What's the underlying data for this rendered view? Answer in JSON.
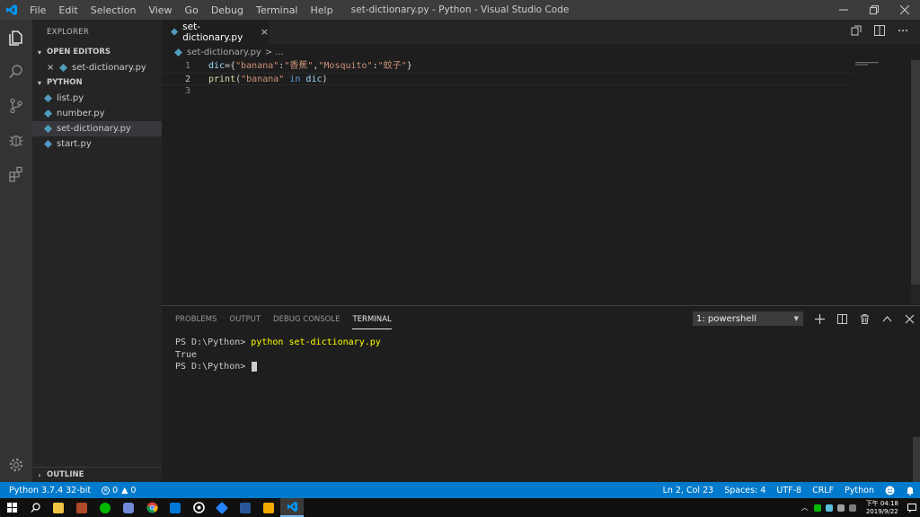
{
  "titlebar": {
    "menu": [
      "File",
      "Edit",
      "Selection",
      "View",
      "Go",
      "Debug",
      "Terminal",
      "Help"
    ],
    "title": "set-dictionary.py - Python - Visual Studio Code",
    "logo_color": "#0098ff"
  },
  "sidebar": {
    "header": "EXPLORER",
    "open_editors_label": "OPEN EDITORS",
    "open_editors": [
      {
        "label": "set-dictionary.py"
      }
    ],
    "folder_label": "PYTHON",
    "files": [
      {
        "label": "list.py"
      },
      {
        "label": "number.py"
      },
      {
        "label": "set-dictionary.py",
        "selected": true
      },
      {
        "label": "start.py"
      }
    ],
    "outline_label": "OUTLINE"
  },
  "editor": {
    "tab_label": "set-dictionary.py",
    "breadcrumb_file": "set-dictionary.py",
    "breadcrumb_more": "> ...",
    "lines": [
      {
        "number": "1",
        "tokens": [
          [
            "dic",
            "var"
          ],
          [
            "={",
            "pun"
          ],
          [
            "\"banana\"",
            "str"
          ],
          [
            ":",
            "pun"
          ],
          [
            "\"香蕉\"",
            "str"
          ],
          [
            ",",
            "pun"
          ],
          [
            "\"Mosquito\"",
            "str"
          ],
          [
            ":",
            "pun"
          ],
          [
            "\"蚊子\"",
            "str"
          ],
          [
            "}",
            "pun"
          ]
        ]
      },
      {
        "number": "2",
        "tokens": [
          [
            "print",
            "fn"
          ],
          [
            "(",
            "pun"
          ],
          [
            "\"banana\"",
            "str"
          ],
          [
            " ",
            "pun"
          ],
          [
            "in",
            "kw"
          ],
          [
            " ",
            "pun"
          ],
          [
            "dic",
            "var"
          ],
          [
            ")",
            "pun"
          ]
        ]
      },
      {
        "number": "3",
        "tokens": []
      }
    ],
    "current_line": 2
  },
  "panel": {
    "tabs": [
      "PROBLEMS",
      "OUTPUT",
      "DEBUG CONSOLE",
      "TERMINAL"
    ],
    "active_tab": "TERMINAL",
    "terminal_selector": "1: powershell",
    "terminal_lines": [
      {
        "prompt": "PS D:\\Python> ",
        "command": "python set-dictionary.py"
      },
      {
        "text": "True"
      },
      {
        "prompt": "PS D:\\Python> ",
        "cursor": true
      }
    ]
  },
  "statusbar": {
    "interpreter": "Python 3.7.4 32-bit",
    "errors": "0",
    "warnings": "0",
    "position": "Ln 2, Col 23",
    "spaces": "Spaces: 4",
    "encoding": "UTF-8",
    "eol": "CRLF",
    "language": "Python",
    "accent": "#007acc"
  },
  "taskbar": {
    "clock_time": "下午 04:18",
    "clock_date": "2019/9/22",
    "apps": [
      "windows-start-icon",
      "search-icon",
      "file-explorer-icon",
      "media-player-icon",
      "line-app-icon",
      "discord-icon",
      "chrome-icon",
      "mail-icon",
      "app-circle-icon",
      "sourcetree-icon",
      "word-icon",
      "notes-icon",
      "vscode-icon"
    ]
  }
}
